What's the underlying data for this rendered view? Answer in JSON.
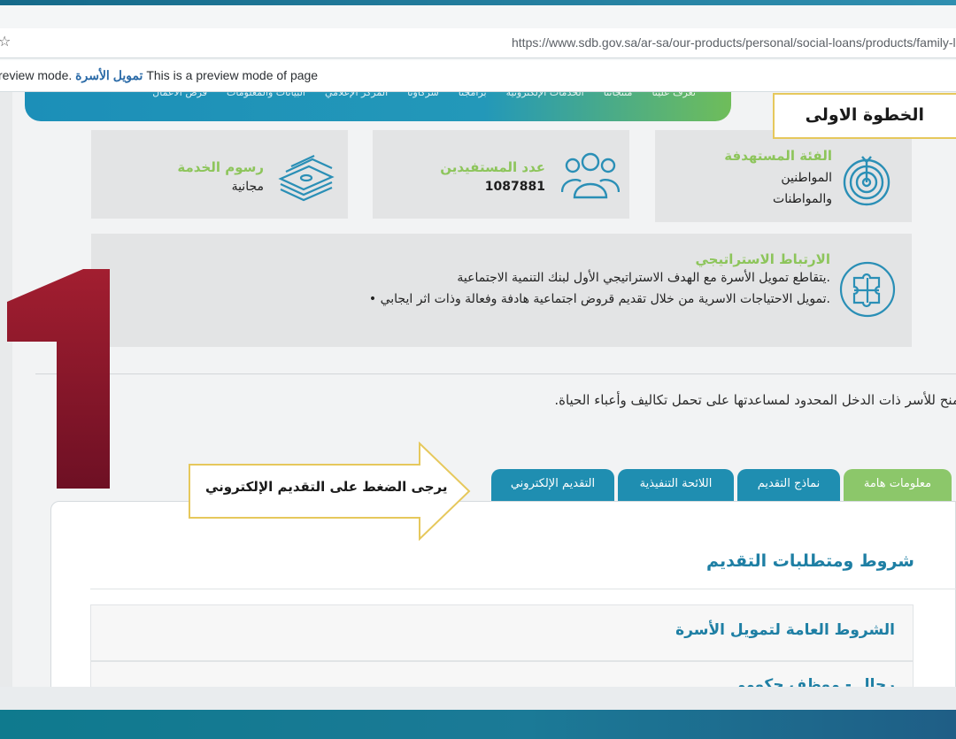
{
  "browser": {
    "url": "https://www.sdb.gov.sa/ar-sa/our-products/personal/social-loans/products/family-l",
    "preview_prefix": "review mode.",
    "preview_title": "تمويل الأسرة",
    "preview_suffix": "This is a preview mode of page"
  },
  "nav": {
    "items": [
      "تعرّف علينا",
      "منتجاتنا",
      "الخدمات الإلكترونية",
      "برامجنا",
      "شركاؤنا",
      "المركز الإعلامي",
      "البيانات والمعلومات",
      "فرص الأعمال"
    ]
  },
  "annotations": {
    "step_label": "الخطوة الاولى",
    "big_number": "1",
    "callout_text": "يرجى الضغط على التقديم الإلكتروني"
  },
  "cards": {
    "target": {
      "title": "الفئة المستهدفة",
      "line1": "المواطنين",
      "line2": "والمواطنات"
    },
    "beneficiaries": {
      "title": "عدد المستفيدين",
      "value": "1087881"
    },
    "fees": {
      "title": "رسوم الخدمة",
      "value": "مجانية"
    },
    "strategy": {
      "title": "الارتباط الاستراتيجي",
      "line1": "يتقاطع تمويل الأسرة مع الهدف الاستراتيجي الأول لبنك التنمية الاجتماعية.",
      "line2": "• تمويل الاحتياجات الاسرية من خلال تقديم قروض اجتماعية هادفة وفعالة وذات اثر ايجابي."
    }
  },
  "description": "منح للأسر ذات الدخل المحدود لمساعدتها على تحمل تكاليف وأعباء الحياة.",
  "tabs": {
    "info": "معلومات هامة",
    "forms": "نماذج التقديم",
    "regulations": "اللائحة التنفيذية",
    "apply": "التقديم الإلكتروني"
  },
  "panel": {
    "title": "شروط ومتطلبات التقديم",
    "accordion": [
      "الشروط العامة لتمويل الأسرة",
      "رجال - موظف حكومي"
    ]
  },
  "colors": {
    "accent_blue": "#1f8eb1",
    "accent_green": "#8cc76a",
    "annotation_red": "#8e1a2c",
    "callout_border": "#e6c85c"
  }
}
